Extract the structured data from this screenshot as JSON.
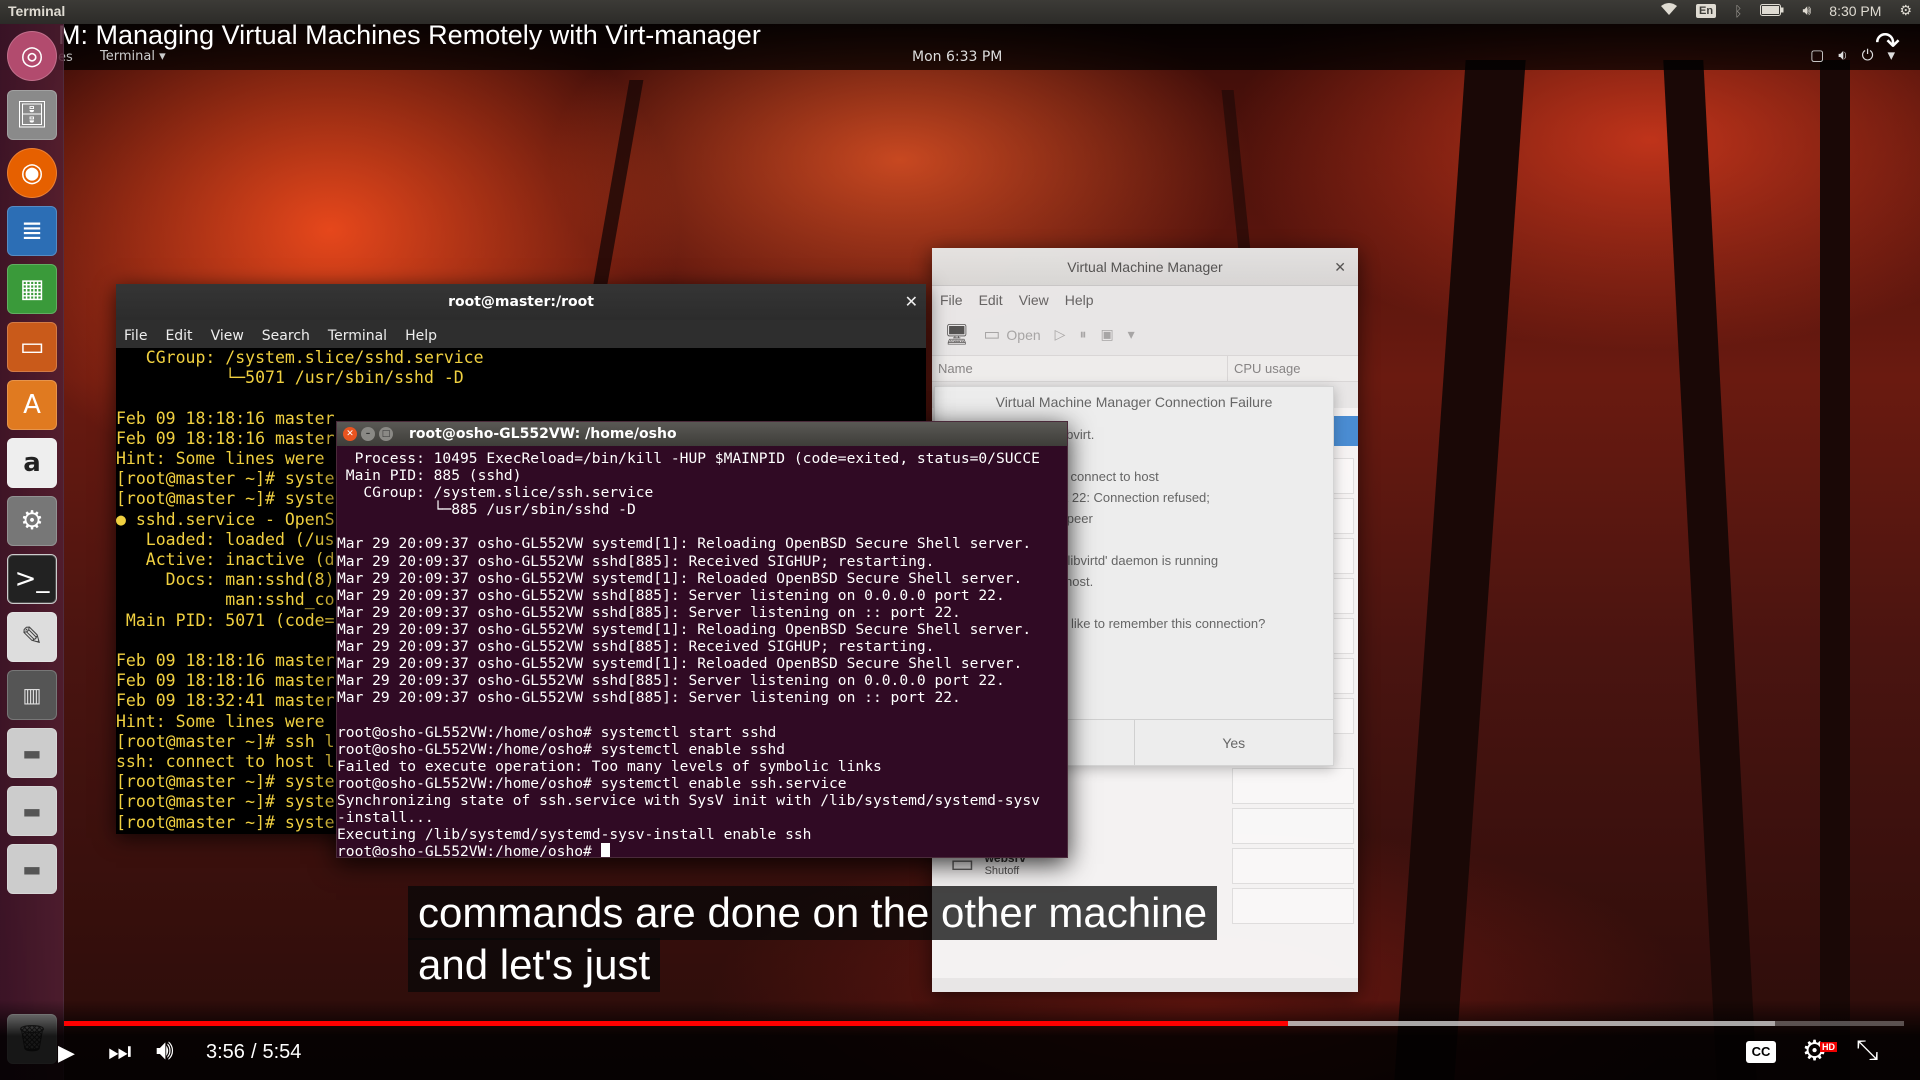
{
  "top_panel": {
    "app_name": "Terminal",
    "keyboard_layout": "En",
    "clock": "8:30 PM",
    "icons": [
      "wifi-icon",
      "bluetooth-icon",
      "battery-icon",
      "volume-icon",
      "gear-icon"
    ]
  },
  "video": {
    "title": "M: Managing Virtual Machines Remotely with Virt-manager",
    "inner_activities": "es",
    "inner_app_menu": "Terminal ▾",
    "inner_clock": "Mon  6:33 PM",
    "captions": [
      "commands are done on the other machine",
      "and let's just"
    ],
    "time_current": "3:56",
    "time_separator": "/",
    "time_total": "5:54",
    "progress_fraction": 0.665,
    "buffer_fraction": 0.93,
    "cc_label": "CC",
    "hd_badge": "HD"
  },
  "launcher": {
    "items": [
      "ubuntu-dash",
      "files",
      "firefox",
      "writer",
      "calc",
      "impress",
      "software-center",
      "amazon",
      "system-settings",
      "terminal",
      "text-editor",
      "virt-manager",
      "drive-1",
      "drive-2",
      "drive-3",
      "trash"
    ]
  },
  "master_terminal": {
    "title": "root@master:/root",
    "menu": [
      "File",
      "Edit",
      "View",
      "Search",
      "Terminal",
      "Help"
    ],
    "lines": [
      "   CGroup: /system.slice/sshd.service",
      "           └─5071 /usr/sbin/sshd -D",
      "",
      "Feb 09 18:18:16 master",
      "Feb 09 18:18:16 master",
      "Hint: Some lines were ",
      "[root@master ~]# syste",
      "[root@master ~]# syste",
      "● sshd.service - OpenS",
      "   Loaded: loaded (/us",
      "   Active: inactive (d",
      "     Docs: man:sshd(8)",
      "           man:sshd_co",
      " Main PID: 5071 (code=",
      "",
      "Feb 09 18:18:16 master",
      "Feb 09 18:18:16 master",
      "Feb 09 18:32:41 master",
      "Hint: Some lines were ",
      "[root@master ~]# ssh l",
      "ssh: connect to host l",
      "[root@master ~]# syste",
      "[root@master ~]# syste",
      "[root@master ~]# syste"
    ]
  },
  "osho_terminal": {
    "title": "root@osho-GL552VW: /home/osho",
    "lines": [
      "  Process: 10495 ExecReload=/bin/kill -HUP $MAINPID (code=exited, status=0/SUCCE",
      " Main PID: 885 (sshd)",
      "   CGroup: /system.slice/ssh.service",
      "           └─885 /usr/sbin/sshd -D",
      "",
      "Mar 29 20:09:37 osho-GL552VW systemd[1]: Reloading OpenBSD Secure Shell server.",
      "Mar 29 20:09:37 osho-GL552VW sshd[885]: Received SIGHUP; restarting.",
      "Mar 29 20:09:37 osho-GL552VW systemd[1]: Reloaded OpenBSD Secure Shell server.",
      "Mar 29 20:09:37 osho-GL552VW sshd[885]: Server listening on 0.0.0.0 port 22.",
      "Mar 29 20:09:37 osho-GL552VW sshd[885]: Server listening on :: port 22.",
      "Mar 29 20:09:37 osho-GL552VW systemd[1]: Reloading OpenBSD Secure Shell server.",
      "Mar 29 20:09:37 osho-GL552VW sshd[885]: Received SIGHUP; restarting.",
      "Mar 29 20:09:37 osho-GL552VW systemd[1]: Reloaded OpenBSD Secure Shell server.",
      "Mar 29 20:09:37 osho-GL552VW sshd[885]: Server listening on 0.0.0.0 port 22.",
      "Mar 29 20:09:37 osho-GL552VW sshd[885]: Server listening on :: port 22.",
      "",
      "root@osho-GL552VW:/home/osho# systemctl start sshd",
      "root@osho-GL552VW:/home/osho# systemctl enable sshd",
      "Failed to execute operation: Too many levels of symbolic links",
      "root@osho-GL552VW:/home/osho# systemctl enable ssh.service",
      "Synchronizing state of ssh.service with SysV init with /lib/systemd/systemd-sysv",
      "-install...",
      "Executing /lib/systemd/systemd-sysv-install enable ssh"
    ],
    "prompt": "root@osho-GL552VW:/home/osho# "
  },
  "vmm": {
    "title": "Virtual Machine Manager",
    "menu": [
      "File",
      "Edit",
      "View",
      "Help"
    ],
    "toolbar_open": "Open",
    "col_name": "Name",
    "col_cpu": "CPU usage",
    "vm_name": "websrv",
    "vm_state": "Shutoff"
  },
  "dialog": {
    "title": "Virtual Machine Manager Connection Failure",
    "lines": [
      "ect to libvirt.",
      "ta: ssh: connect to host",
      "5 port 22: Connection refused;",
      "et by peer",
      "'libvirtd' daemon is running",
      "host.",
      "like to remember this connection?"
    ],
    "btn_no": "",
    "btn_yes": "Yes"
  }
}
